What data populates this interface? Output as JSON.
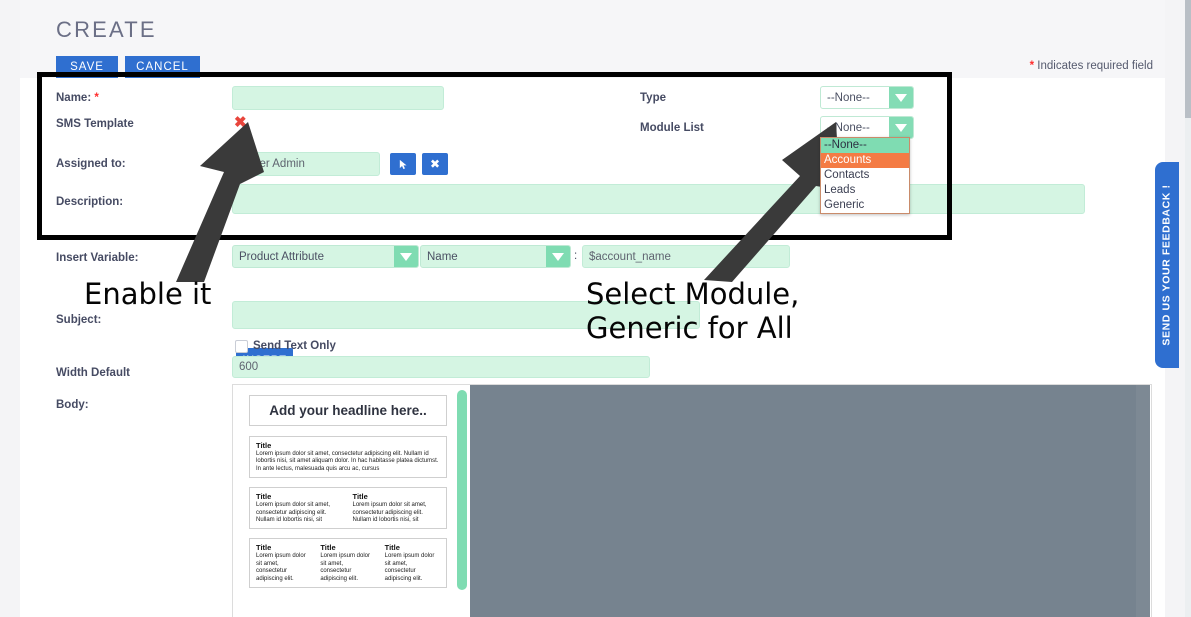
{
  "header": {
    "title": "CREATE",
    "save_label": "SAVE",
    "cancel_label": "CANCEL",
    "required_star": "*",
    "required_note": " Indicates required field"
  },
  "form": {
    "name": {
      "label": "Name:",
      "star": "*",
      "value": "",
      "placeholder": ""
    },
    "sms_template": {
      "label": "SMS Template",
      "icon": "red-x-icon",
      "glyph": "✖"
    },
    "assigned_to": {
      "label": "Assigned to:",
      "value": "Super Admin",
      "select_button_icon": "cursor-select-icon",
      "clear_button_icon": "close-icon",
      "clear_glyph": "✖"
    },
    "description": {
      "label": "Description:",
      "value": ""
    },
    "type": {
      "label": "Type",
      "value": "--None--"
    },
    "module_list": {
      "label": "Module List",
      "value": "--None--",
      "open": true,
      "options": [
        "--None--",
        "Accounts",
        "Contacts",
        "Leads",
        "Generic"
      ],
      "highlighted": "Accounts"
    },
    "insert_variable": {
      "label": "Insert Variable:",
      "module_value": "Product Attribute",
      "field_value": "Name",
      "separator": ":",
      "token_value": "$account_name",
      "insert_label": "INSERT"
    },
    "subject": {
      "label": "Subject:",
      "value": ""
    },
    "send_text_only": {
      "label": "Send Text Only",
      "checked": false
    },
    "width_default": {
      "label": "Width Default",
      "value": "600"
    },
    "body": {
      "label": "Body:"
    }
  },
  "body_preview": {
    "headline": "Add your headline here..",
    "blocks": [
      {
        "columns": [
          {
            "title": "Title",
            "text": "Lorem ipsum dolor sit amet, consectetur adipiscing elit. Nullam id lobortis nisi, sit amet aliquam dolor. In hac habitasse platea dictumst. In ante lectus, malesuada quis arcu ac, cursus"
          }
        ]
      },
      {
        "columns": [
          {
            "title": "Title",
            "text": "Lorem ipsum dolor sit amet, consectetur adipiscing elit. Nullam id lobortis nisi, sit"
          },
          {
            "title": "Title",
            "text": "Lorem ipsum dolor sit amet, consectetur adipiscing elit. Nullam id lobortis nisi, sit"
          }
        ]
      },
      {
        "columns": [
          {
            "title": "Title",
            "text": "Lorem ipsum dolor sit amet, consectetur adipiscing elit."
          },
          {
            "title": "Title",
            "text": "Lorem ipsum dolor sit amet, consectetur adipiscing elit."
          },
          {
            "title": "Title",
            "text": "Lorem ipsum dolor sit amet, consectetur adipiscing elit."
          }
        ]
      }
    ]
  },
  "annotations": {
    "enable_it": "Enable it",
    "select_module": "Select Module,\nGeneric for All"
  },
  "feedback_tab": {
    "label": "SEND US YOUR FEEDBACK !"
  },
  "colors": {
    "accent_blue": "#2f6fd0",
    "mint_field": "#d5f5e3",
    "mint_arrow": "#84dcb5",
    "highlight_orange": "#f47b44",
    "required_red": "#ff2d2d",
    "canvas_grey": "#76838f"
  }
}
